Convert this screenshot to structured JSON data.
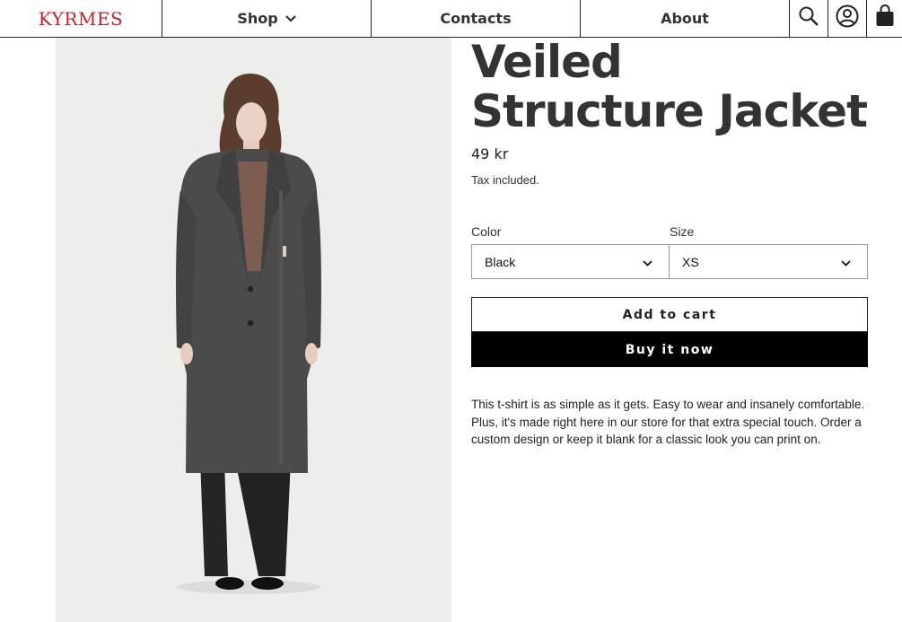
{
  "header": {
    "logo": "KYRMES",
    "nav": [
      {
        "label": "Shop"
      },
      {
        "label": "Contacts"
      },
      {
        "label": "About"
      }
    ],
    "icons": [
      "search-icon",
      "account-icon",
      "cart-bag-icon"
    ]
  },
  "product": {
    "title": "Veiled Structure Jacket",
    "price": "49 kr",
    "tax_note": "Tax included.",
    "color_label": "Color",
    "color_value": "Black",
    "size_label": "Size",
    "size_value": "XS",
    "add_to_cart": "Add to cart",
    "buy_now": "Buy it now",
    "description": "This t-shirt is as simple as it gets. Easy to wear and insanely comfortable. Plus, it's made right here in our store for that extra special touch. Order a custom design or keep it blank for a classic look you can print on."
  },
  "colors": {
    "brand": "#c8202a",
    "buy_button": "#000000",
    "image_background": "#ededec",
    "coat": "#4a4b4a"
  }
}
